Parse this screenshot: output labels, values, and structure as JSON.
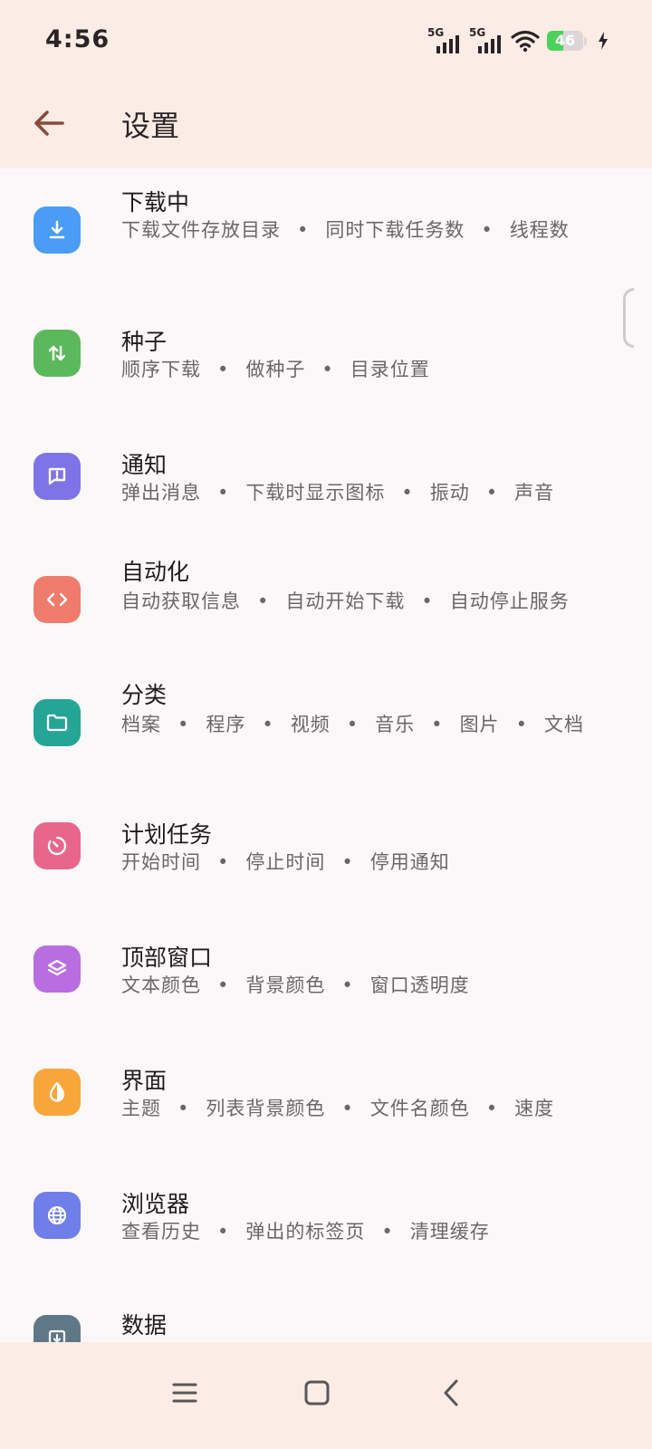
{
  "status_bar": {
    "time": "4:56",
    "signal_1_label": "5G",
    "signal_2_label": "5G",
    "battery_level": "46",
    "battery_percent": 46,
    "battery_color": "#4cd25a",
    "charging": true,
    "icons": [
      "signal-icon",
      "signal-icon",
      "wifi-icon",
      "battery-icon",
      "charging-bolt-icon"
    ]
  },
  "app_bar": {
    "title": "设置",
    "back_icon": "back-arrow-icon"
  },
  "settings": [
    {
      "title": "下载中",
      "subtitle_items": [
        "下载文件存放目录",
        "同时下载任务数",
        "线程数"
      ],
      "icon": "download-icon",
      "icon_color": "#4a9cf5"
    },
    {
      "title": "种子",
      "subtitle_items": [
        "顺序下载",
        "做种子",
        "目录位置"
      ],
      "icon": "swap-vertical-icon",
      "icon_color": "#5cb85c"
    },
    {
      "title": "通知",
      "subtitle_items": [
        "弹出消息",
        "下载时显示图标",
        "振动",
        "声音"
      ],
      "icon": "message-alert-icon",
      "icon_color": "#7f73e8"
    },
    {
      "title": "自动化",
      "subtitle_items": [
        "自动获取信息",
        "自动开始下载",
        "自动停止服务"
      ],
      "icon": "code-icon",
      "icon_color": "#ee7b6b"
    },
    {
      "title": "分类",
      "subtitle_items": [
        "档案",
        "程序",
        "视频",
        "音乐",
        "图片",
        "文档"
      ],
      "icon": "folder-icon",
      "icon_color": "#24a596"
    },
    {
      "title": "计划任务",
      "subtitle_items": [
        "开始时间",
        "停止时间",
        "停用通知"
      ],
      "icon": "timer-icon",
      "icon_color": "#e8668c"
    },
    {
      "title": "顶部窗口",
      "subtitle_items": [
        "文本颜色",
        "背景颜色",
        "窗口透明度"
      ],
      "icon": "layers-icon",
      "icon_color": "#b86ee0"
    },
    {
      "title": "界面",
      "subtitle_items": [
        "主题",
        "列表背景颜色",
        "文件名颜色",
        "速度"
      ],
      "icon": "theme-drop-icon",
      "icon_color": "#f8a63a"
    },
    {
      "title": "浏览器",
      "subtitle_items": [
        "查看历史",
        "弹出的标签页",
        "清理缓存"
      ],
      "icon": "globe-icon",
      "icon_color": "#6f7ee8"
    },
    {
      "title": "数据",
      "subtitle_items": [],
      "icon": "archive-icon",
      "icon_color": "#5f7888"
    }
  ],
  "nav_bar": {
    "icons": [
      "menu-icon",
      "home-square-icon",
      "back-chevron-icon"
    ]
  }
}
